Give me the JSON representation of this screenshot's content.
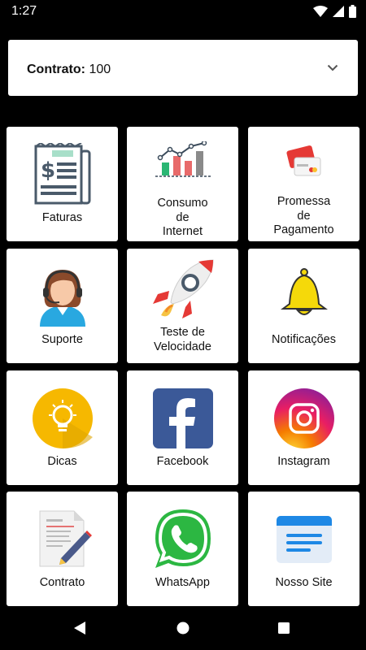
{
  "status": {
    "time": "1:27"
  },
  "contract": {
    "label": "Contrato:",
    "value": "100"
  },
  "tiles": [
    {
      "label": "Faturas",
      "icon": "invoice-icon"
    },
    {
      "label": "Consumo\nde\nInternet",
      "icon": "chart-icon"
    },
    {
      "label": "Promessa\nde\nPagamento",
      "icon": "cards-icon"
    },
    {
      "label": "Suporte",
      "icon": "support-agent-icon"
    },
    {
      "label": "Teste de\nVelocidade",
      "icon": "rocket-icon"
    },
    {
      "label": "Notificações",
      "icon": "bell-icon"
    },
    {
      "label": "Dicas",
      "icon": "lightbulb-icon"
    },
    {
      "label": "Facebook",
      "icon": "facebook-icon"
    },
    {
      "label": "Instagram",
      "icon": "instagram-icon"
    },
    {
      "label": "Contrato",
      "icon": "contract-document-icon"
    },
    {
      "label": "WhatsApp",
      "icon": "whatsapp-icon"
    },
    {
      "label": "Nosso Site",
      "icon": "website-icon"
    }
  ]
}
